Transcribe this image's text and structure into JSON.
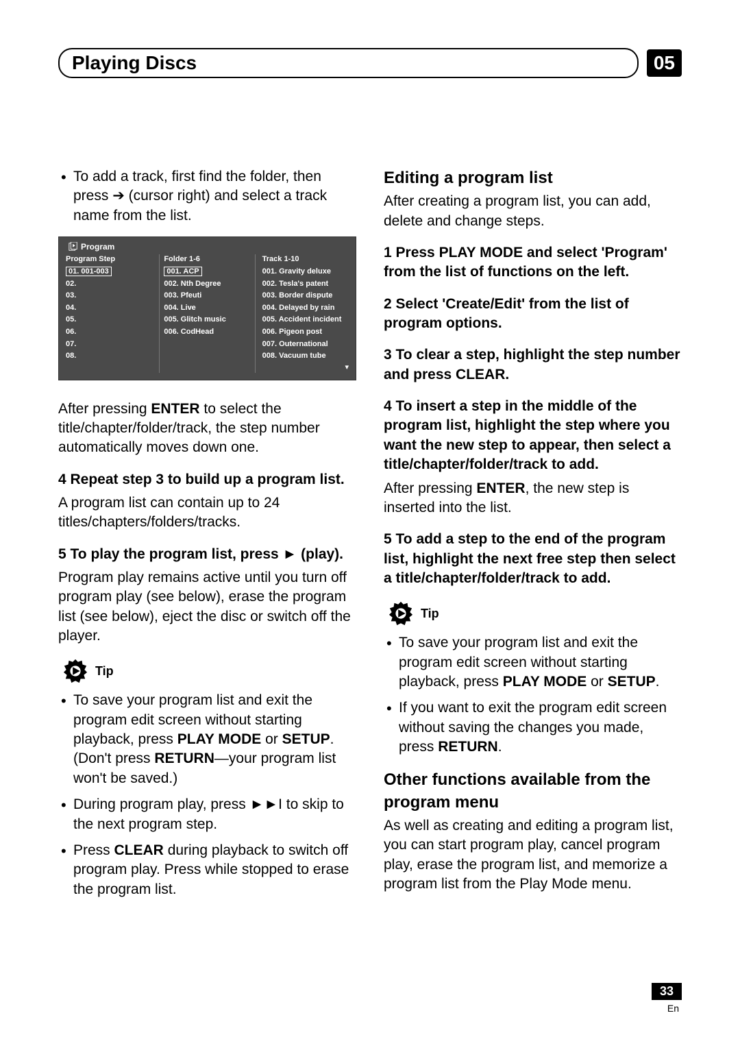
{
  "header": {
    "title": "Playing Discs",
    "chapter": "05"
  },
  "left": {
    "intro_bullet": {
      "a": "To add a track, first find the folder, then press ",
      "b": " (cursor right) and select a track name from the list."
    },
    "after_enter": {
      "a": "After pressing ",
      "b": "ENTER",
      "c": " to select the title/chapter/folder/track, the step number automatically moves down one."
    },
    "step4": {
      "title": "4   Repeat step 3 to build up a program list.",
      "body": "A program list can contain up to 24 titles/chapters/folders/tracks."
    },
    "step5": {
      "title_a": "5   To play the program list, press ",
      "title_b": " (play).",
      "body": "Program play remains active until you turn off program play (see below), erase the program list (see below), eject the disc or switch off the player."
    },
    "tip_label": "Tip",
    "tips": {
      "t1a": "To save your program list and exit the program edit screen without starting playback, press ",
      "t1b": "PLAY MODE",
      "t1c": " or ",
      "t1d": "SETUP",
      "t1e": ". (Don't press ",
      "t1f": "RETURN",
      "t1g": "—your program list won't be saved.)",
      "t2a": "During program play, press ",
      "t2b": " to skip to the next program step.",
      "t3a": "Press ",
      "t3b": "CLEAR",
      "t3c": " during playback to switch off program play. Press while stopped to erase the program list."
    },
    "table": {
      "title": "Program",
      "heads": {
        "c1": "Program Step",
        "c2": "Folder 1-6",
        "c3": "Track 1-10"
      },
      "col1": [
        "01. 001-003",
        "02.",
        "03.",
        "04.",
        "05.",
        "06.",
        "07.",
        "08."
      ],
      "col2": [
        "001. ACP",
        "002. Nth Degree",
        "003. Pfeuti",
        "004. Live",
        "005. Glitch music",
        "006. CodHead"
      ],
      "col3": [
        "001. Gravity deluxe",
        "002. Tesla's patent",
        "003. Border dispute",
        "004. Delayed by rain",
        "005. Accident incident",
        "006. Pigeon post",
        "007. Outernational",
        "008. Vacuum tube"
      ]
    }
  },
  "right": {
    "h_edit": "Editing a program list",
    "edit_intro": "After creating a program list, you can add, delete and change steps.",
    "s1": "1   Press PLAY MODE and select 'Program' from the list of functions on the left.",
    "s2": "2   Select 'Create/Edit' from the list of program options.",
    "s3": "3   To clear a step, highlight the step number and press CLEAR.",
    "s4a": "4   To insert a step in the middle of the program list, highlight the step where you want the new step to appear, then select a title/chapter/folder/track to add.",
    "s4b_a": "After pressing ",
    "s4b_b": "ENTER",
    "s4b_c": ", the new step is inserted into the list.",
    "s5": "5   To add a step to the end of the program list, highlight the next free step then select a title/chapter/folder/track to add.",
    "tip_label": "Tip",
    "tips": {
      "t1a": "To save your program list and exit the program edit screen without starting playback, press ",
      "t1b": "PLAY MODE",
      "t1c": " or ",
      "t1d": "SETUP",
      "t1e": ".",
      "t2a": "If you want to exit the program edit screen without saving the changes you made, press ",
      "t2b": "RETURN",
      "t2c": "."
    },
    "h_other": "Other functions available from the program menu",
    "other_body": "As well as creating and editing a program list, you can start program play, cancel program play, erase the program list, and memorize a program list from the Play Mode menu."
  },
  "footer": {
    "page": "33",
    "lang": "En"
  }
}
